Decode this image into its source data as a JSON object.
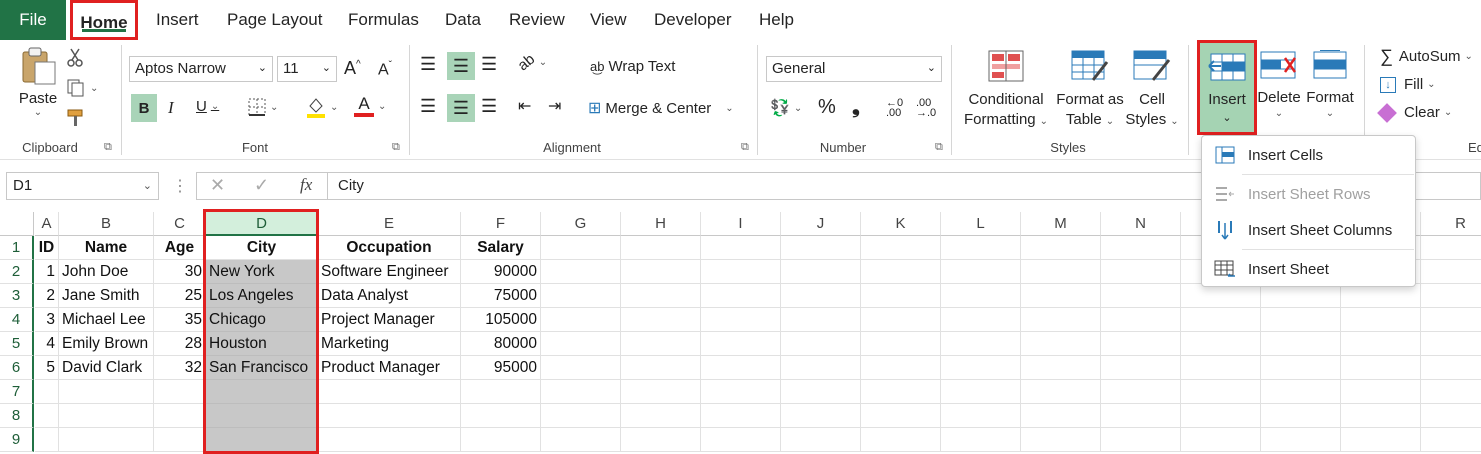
{
  "tabs": [
    "File",
    "Home",
    "Insert",
    "Page Layout",
    "Formulas",
    "Data",
    "Review",
    "View",
    "Developer",
    "Help"
  ],
  "clipboard": {
    "paste": "Paste",
    "group": "Clipboard"
  },
  "font": {
    "name": "Aptos Narrow",
    "size": "11",
    "group": "Font"
  },
  "alignment": {
    "wrap": "Wrap Text",
    "merge": "Merge & Center",
    "group": "Alignment"
  },
  "number": {
    "format": "General",
    "group": "Number"
  },
  "styles": {
    "conditional_1": "Conditional",
    "conditional_2": "Formatting",
    "format_table_1": "Format as",
    "format_table_2": "Table",
    "cell_styles_1": "Cell",
    "cell_styles_2": "Styles",
    "group": "Styles"
  },
  "cells_group": {
    "insert": "Insert",
    "delete": "Delete",
    "format": "Format"
  },
  "editing": {
    "autosum": "AutoSum",
    "fill": "Fill",
    "clear": "Clear",
    "group_partial": "Ed"
  },
  "formula_bar": {
    "name_box": "D1",
    "fx": "fx",
    "content": "City"
  },
  "columns": [
    "A",
    "B",
    "C",
    "D",
    "E",
    "F",
    "G",
    "H",
    "I",
    "J",
    "K",
    "L",
    "M",
    "N",
    "O",
    "P",
    "Q",
    "R"
  ],
  "rows": [
    "1",
    "2",
    "3",
    "4",
    "5",
    "6",
    "7",
    "8",
    "9"
  ],
  "headers": [
    "ID",
    "Name",
    "Age",
    "City",
    "Occupation",
    "Salary"
  ],
  "data": [
    [
      "1",
      "John Doe",
      "30",
      "New York",
      "Software Engineer",
      "90000"
    ],
    [
      "2",
      "Jane Smith",
      "25",
      "Los Angeles",
      "Data Analyst",
      "75000"
    ],
    [
      "3",
      "Michael Lee",
      "35",
      "Chicago",
      "Project Manager",
      "105000"
    ],
    [
      "4",
      "Emily Brown",
      "28",
      "Houston",
      "Marketing",
      "80000"
    ],
    [
      "5",
      "David Clark",
      "32",
      "San Francisco",
      "Product Manager",
      "95000"
    ]
  ],
  "insert_menu": {
    "insert_cells": "Insert Cells",
    "insert_rows": "Insert Sheet Rows",
    "insert_columns": "Insert Sheet Columns",
    "insert_sheet": "Insert Sheet"
  },
  "colors": {
    "accent": "#217346",
    "highlight": "#e02020",
    "selected_fill": "#c8c8c8"
  },
  "icons": [
    "paste-icon",
    "cut-icon",
    "copy-icon",
    "format-painter-icon",
    "bold-icon",
    "italic-icon",
    "underline-icon",
    "borders-icon",
    "fill-color-icon",
    "font-color-icon",
    "wrap-text-icon",
    "merge-icon",
    "currency-icon",
    "percent-icon",
    "comma-icon",
    "increase-decimal-icon",
    "decrease-decimal-icon",
    "conditional-formatting-icon",
    "format-table-icon",
    "cell-styles-icon",
    "insert-icon",
    "delete-icon",
    "format-icon",
    "autosum-icon",
    "fill-icon",
    "clear-icon"
  ]
}
